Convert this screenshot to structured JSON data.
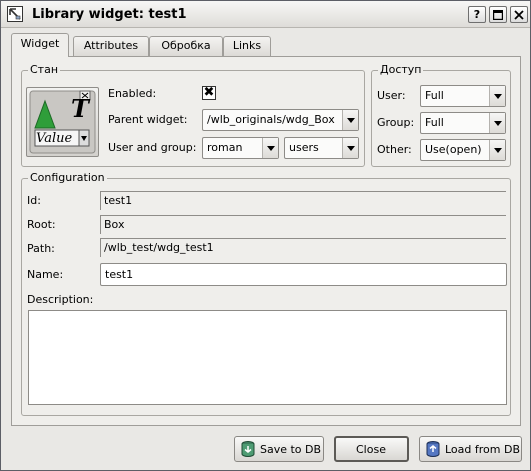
{
  "window": {
    "title": "Library widget: test1",
    "buttons": {
      "help": "?",
      "maximize": "□",
      "close": "✕"
    }
  },
  "tabs": [
    {
      "label": "Widget",
      "active": true
    },
    {
      "label": "Attributes",
      "active": false
    },
    {
      "label": "Обробка",
      "active": false
    },
    {
      "label": "Links",
      "active": false
    }
  ],
  "stan": {
    "title": "Стан",
    "enabled_label": "Enabled:",
    "enabled": true,
    "enabled_mark": "✖",
    "parent_label": "Parent widget:",
    "parent_value": "/wlb_originals/wdg_Box",
    "user_group_label": "User and group:",
    "user_value": "roman",
    "group_value": "users",
    "icon_text_t": "T",
    "icon_text_value": "Value"
  },
  "dostup": {
    "title": "Доступ",
    "user_label": "User:",
    "user_value": "Full",
    "group_label": "Group:",
    "group_value": "Full",
    "other_label": "Other:",
    "other_value": "Use(open)"
  },
  "configuration": {
    "title": "Configuration",
    "id_label": "Id:",
    "id_value": "test1",
    "root_label": "Root:",
    "root_value": "Box",
    "path_label": "Path:",
    "path_value": "/wlb_test/wdg_test1",
    "name_label": "Name:",
    "name_value": "test1",
    "description_label": "Description:",
    "description_value": ""
  },
  "footer": {
    "save_label": "Save to DB",
    "close_label": "Close",
    "load_label": "Load from DB"
  }
}
